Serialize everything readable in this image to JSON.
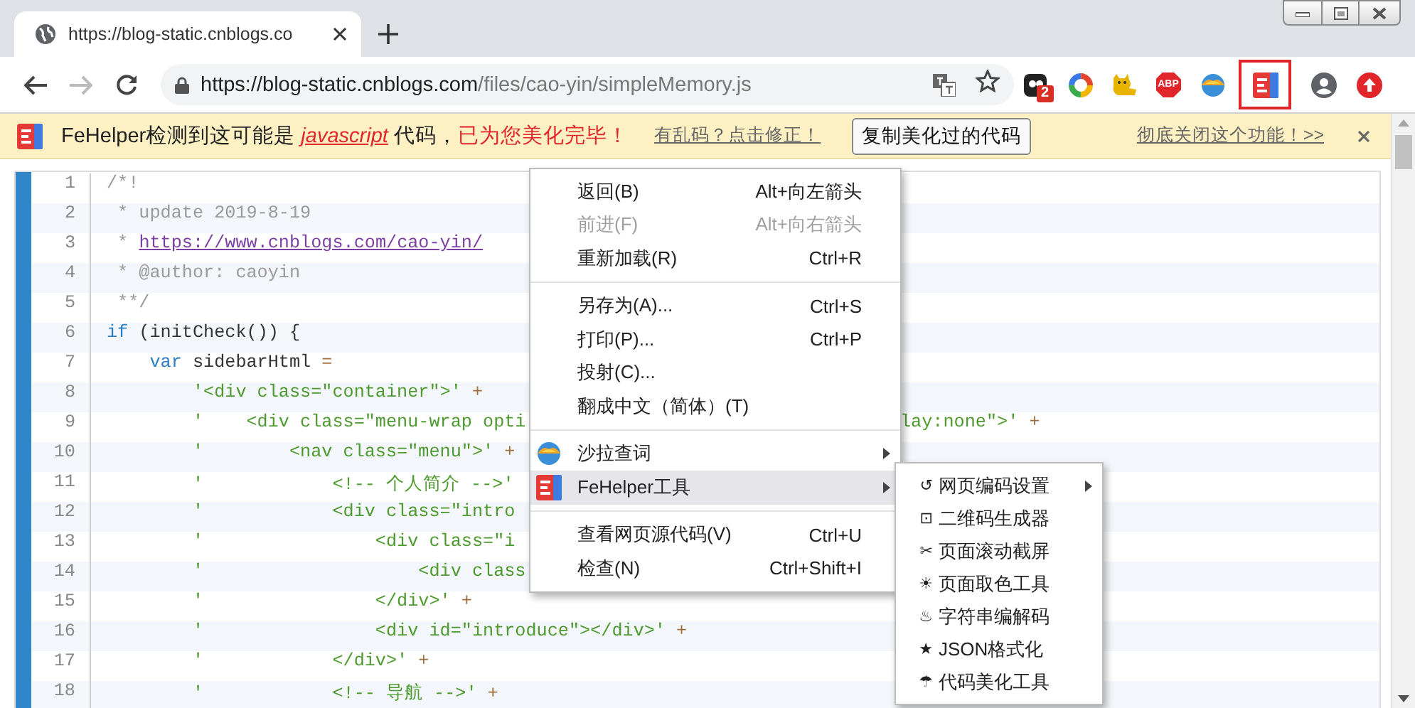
{
  "browser": {
    "tab": {
      "title": "https://blog-static.cnblogs.co"
    },
    "back": {
      "disabled": false
    },
    "forward": {
      "disabled": true
    },
    "address": {
      "host": "https://blog-static.cnblogs.com",
      "path": "/files/cao-yin/simpleMemory.js"
    },
    "extensions": [
      {
        "kind": "dark",
        "badge": "2",
        "highlighted": false
      },
      {
        "kind": "ring",
        "highlighted": false
      },
      {
        "kind": "cat",
        "highlighted": false
      },
      {
        "kind": "adblock",
        "label": "ABP",
        "highlighted": false
      },
      {
        "kind": "bowl",
        "highlighted": false
      },
      {
        "kind": "fehelper",
        "highlighted": true
      }
    ]
  },
  "infobar": {
    "message": [
      {
        "kind": "plain",
        "text": "FeHelper检测到这可能是 "
      },
      {
        "kind": "language",
        "text": "javascript"
      },
      {
        "kind": "plain",
        "text": " 代码，"
      },
      {
        "kind": "notice",
        "text": "已为您美化完毕！"
      }
    ],
    "fix_link": "有乱码？点击修正！",
    "copy_button": "复制美化过的代码",
    "disable_link": "彻底关闭这个功能！>>"
  },
  "code": {
    "lines": [
      {
        "number": "1",
        "tokens": [
          {
            "kind": "comment",
            "text": "/*!"
          }
        ]
      },
      {
        "number": "2",
        "tokens": [
          {
            "kind": "comment",
            "text": " * update 2019-8-19"
          }
        ]
      },
      {
        "number": "3",
        "tokens": [
          {
            "kind": "comment",
            "text": " * "
          },
          {
            "kind": "link",
            "text": "https://www.cnblogs.com/cao-yin/"
          }
        ]
      },
      {
        "number": "4",
        "tokens": [
          {
            "kind": "comment",
            "text": " * @author: caoyin"
          }
        ]
      },
      {
        "number": "5",
        "tokens": [
          {
            "kind": "comment",
            "text": " **/"
          }
        ]
      },
      {
        "number": "6",
        "tokens": [
          {
            "kind": "keyword",
            "text": "if"
          },
          {
            "kind": "plain",
            "text": " (initCheck()) {"
          }
        ]
      },
      {
        "number": "7",
        "tokens": [
          {
            "kind": "keyword",
            "text": "    var"
          },
          {
            "kind": "plain",
            "text": " sidebarHtml"
          },
          {
            "kind": "operator",
            "text": " ="
          }
        ]
      },
      {
        "number": "8",
        "tokens": [
          {
            "kind": "string",
            "text": "        '<div class=\"container\">'"
          },
          {
            "kind": "operator",
            "text": " +"
          }
        ]
      },
      {
        "number": "9",
        "tokens": [
          {
            "kind": "string",
            "text": "        '    <div class=\"menu-wrap opti"
          }
        ],
        "tail": [
          {
            "kind": "string",
            "text": "lay:none\">'"
          },
          {
            "kind": "operator",
            "text": " +"
          }
        ]
      },
      {
        "number": "10",
        "tokens": [
          {
            "kind": "string",
            "text": "        '        <nav class=\"menu\">'"
          },
          {
            "kind": "operator",
            "text": " +"
          }
        ]
      },
      {
        "number": "11",
        "tokens": [
          {
            "kind": "string",
            "text": "        '            <!-- 个人简介 -->'"
          }
        ]
      },
      {
        "number": "12",
        "tokens": [
          {
            "kind": "string",
            "text": "        '            <div class=\"intro"
          }
        ]
      },
      {
        "number": "13",
        "tokens": [
          {
            "kind": "string",
            "text": "        '                <div class=\"i"
          }
        ]
      },
      {
        "number": "14",
        "tokens": [
          {
            "kind": "string",
            "text": "        '                    <div class"
          }
        ]
      },
      {
        "number": "15",
        "tokens": [
          {
            "kind": "string",
            "text": "        '                </div>'"
          },
          {
            "kind": "operator",
            "text": " +"
          }
        ]
      },
      {
        "number": "16",
        "tokens": [
          {
            "kind": "string",
            "text": "        '                <div id=\"introduce\"></div>'"
          },
          {
            "kind": "operator",
            "text": " +"
          }
        ]
      },
      {
        "number": "17",
        "tokens": [
          {
            "kind": "string",
            "text": "        '            </div>'"
          },
          {
            "kind": "operator",
            "text": " +"
          }
        ]
      },
      {
        "number": "18",
        "tokens": [
          {
            "kind": "string",
            "text": "        '            <!-- 导航 -->'"
          },
          {
            "kind": "operator",
            "text": " +"
          }
        ]
      }
    ]
  },
  "context_menu": {
    "items": [
      {
        "kind": "command",
        "label": "返回(B)",
        "shortcut": "Alt+向左箭头",
        "disabled": false,
        "selected": false,
        "submenu": false
      },
      {
        "kind": "command",
        "label": "前进(F)",
        "shortcut": "Alt+向右箭头",
        "disabled": true,
        "selected": false,
        "submenu": false
      },
      {
        "kind": "command",
        "label": "重新加载(R)",
        "shortcut": "Ctrl+R",
        "disabled": false,
        "selected": false,
        "submenu": false
      },
      {
        "kind": "separator"
      },
      {
        "kind": "command",
        "label": "另存为(A)...",
        "shortcut": "Ctrl+S",
        "disabled": false,
        "selected": false,
        "submenu": false
      },
      {
        "kind": "command",
        "label": "打印(P)...",
        "shortcut": "Ctrl+P",
        "disabled": false,
        "selected": false,
        "submenu": false
      },
      {
        "kind": "command",
        "label": "投射(C)...",
        "disabled": false,
        "selected": false,
        "submenu": false
      },
      {
        "kind": "command",
        "label": "翻成中文（简体）(T)",
        "disabled": false,
        "selected": false,
        "submenu": false
      },
      {
        "kind": "separator"
      },
      {
        "kind": "dictionary",
        "label": "沙拉查词",
        "disabled": false,
        "selected": false,
        "submenu": true
      },
      {
        "kind": "fehelper",
        "label": "FeHelper工具",
        "disabled": false,
        "selected": true,
        "submenu": true
      },
      {
        "kind": "separator"
      },
      {
        "kind": "command",
        "label": "查看网页源代码(V)",
        "shortcut": "Ctrl+U",
        "disabled": false,
        "selected": false,
        "submenu": false
      },
      {
        "kind": "command",
        "label": "检查(N)",
        "shortcut": "Ctrl+Shift+I",
        "disabled": false,
        "selected": false,
        "submenu": false
      }
    ]
  },
  "submenu": {
    "items": [
      {
        "glyph": "↺",
        "label": "网页编码设置",
        "selected": false,
        "submenu": true
      },
      {
        "glyph": "⊡",
        "label": "二维码生成器",
        "selected": false,
        "submenu": false
      },
      {
        "glyph": "✂",
        "label": "页面滚动截屏",
        "selected": false,
        "submenu": false
      },
      {
        "glyph": "☀",
        "label": "页面取色工具",
        "selected": false,
        "submenu": false
      },
      {
        "glyph": "♨",
        "label": "字符串编解码",
        "selected": false,
        "submenu": false
      },
      {
        "glyph": "★",
        "label": "JSON格式化",
        "selected": false,
        "submenu": false
      },
      {
        "glyph": "☂",
        "label": "代码美化工具",
        "selected": false,
        "submenu": false
      }
    ]
  }
}
